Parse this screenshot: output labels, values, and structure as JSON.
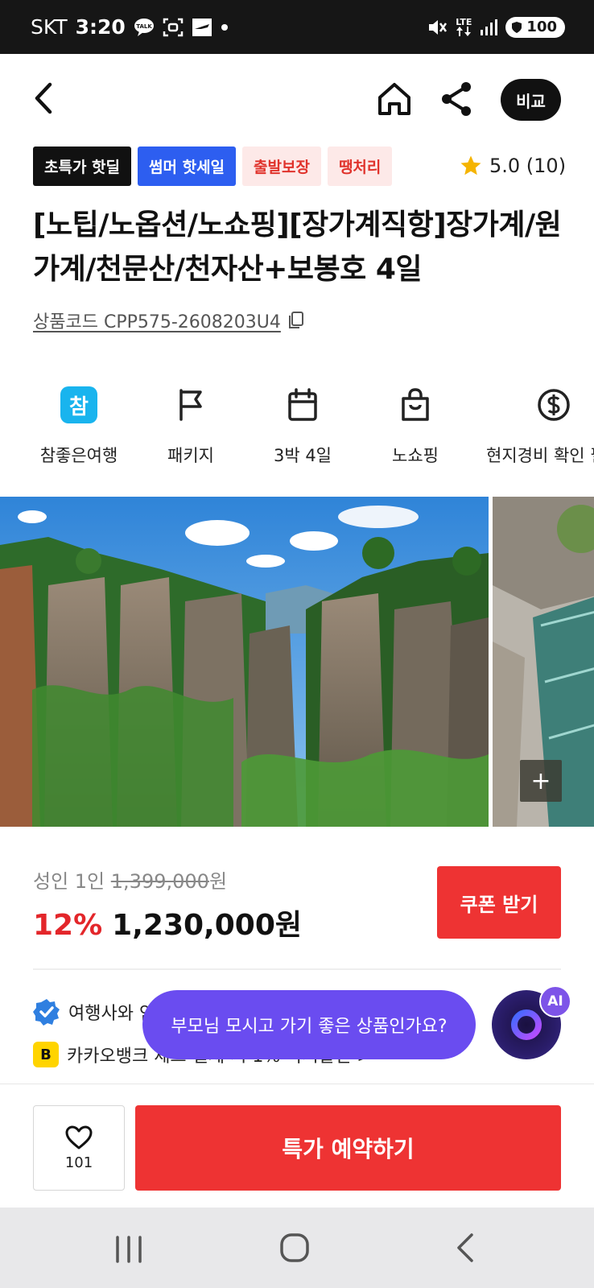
{
  "status_bar": {
    "carrier": "SKT",
    "time": "3:20",
    "battery": "100",
    "network": "LTE"
  },
  "top_nav": {
    "compare_label": "비교"
  },
  "badges": [
    "초특가 핫딜",
    "썸머 핫세일",
    "출발보장",
    "땡처리"
  ],
  "rating": {
    "text": "5.0 (10)",
    "value": 5.0,
    "count": 10,
    "star_color": "#f5b400"
  },
  "product": {
    "title": "[노팁/노옵션/노쇼핑][장가계직항]장가계/원가계/천문산/천자산+보봉호 4일",
    "code_text": "상품코드 CPP575-2608203U4"
  },
  "info_items": [
    {
      "icon": "chamjoeun-logo",
      "logo_char": "참",
      "label": "참좋은여행"
    },
    {
      "icon": "flag-icon",
      "label": "패키지"
    },
    {
      "icon": "calendar-icon",
      "label": "3박 4일"
    },
    {
      "icon": "shopping-bag-icon",
      "label": "노쇼핑"
    },
    {
      "icon": "dollar-icon",
      "label": "현지경비 확인 필"
    }
  ],
  "gallery": {
    "more_label": "+"
  },
  "price": {
    "per_person_label": "성인 1인",
    "original_price": "1,399,000",
    "currency_suffix": "원",
    "discount_rate": "12%",
    "sale_price": "1,230,000원",
    "coupon_label": "쿠폰 받기"
  },
  "benefits": {
    "item1": "여행사와 안심하고 거래하세요 · 보장",
    "item2": "카카오뱅크 체크 결제 시 1% 즉시할인 >",
    "kb_letter": "B"
  },
  "ai": {
    "bubble_text": "부모님 모시고 가기 좋은 상품인가요?",
    "badge": "AI"
  },
  "bottom_bar": {
    "like_count": "101",
    "book_label": "특가 예약하기"
  },
  "colors": {
    "accent_red": "#ee3333",
    "badge_blue": "#2d5ef0",
    "ai_purple": "#6a4cf0"
  }
}
